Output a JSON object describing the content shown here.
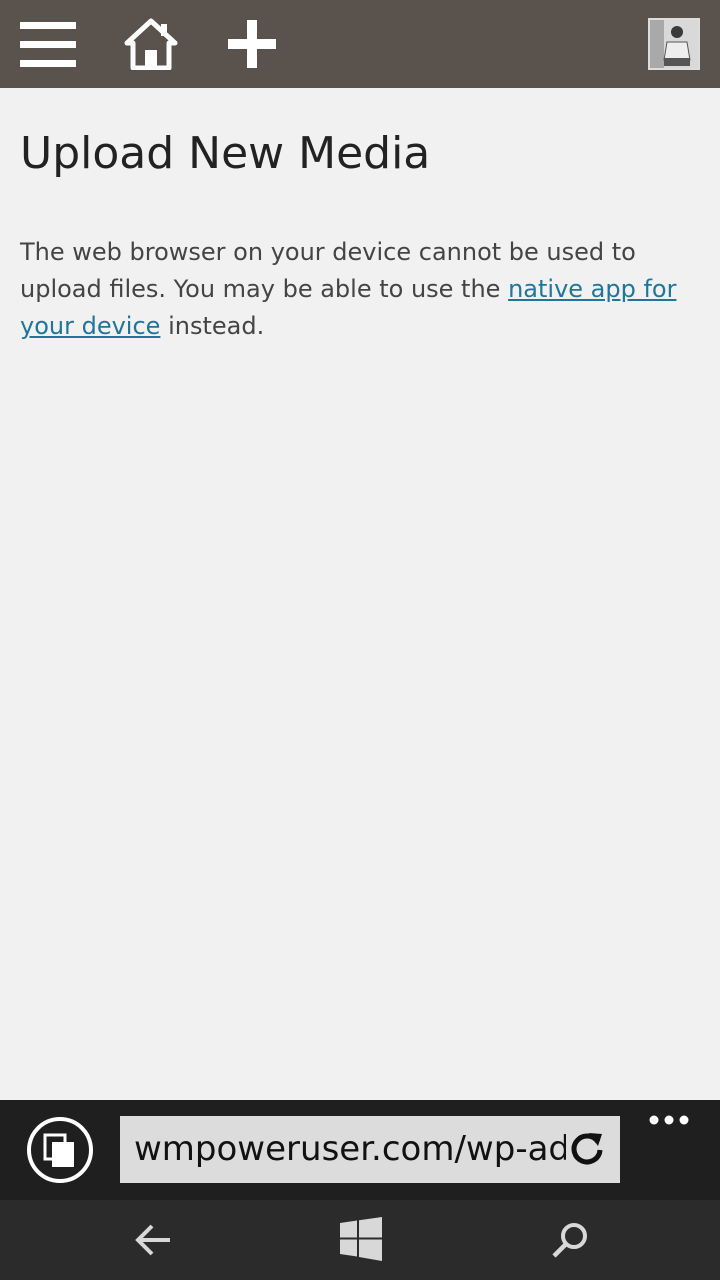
{
  "header": {
    "icons": [
      "menu-icon",
      "home-icon",
      "plus-icon",
      "user-avatar"
    ]
  },
  "page": {
    "title": "Upload New Media",
    "notice_before": "The web browser on your device cannot be used to upload files. You may be able to use the ",
    "notice_link": "native app for your device",
    "notice_after": " instead."
  },
  "browser": {
    "address": "wmpoweruser.com/wp-admin/media-new.php",
    "icons": [
      "tabs-icon",
      "refresh-icon",
      "more-icon"
    ]
  },
  "system_nav": {
    "icons": [
      "back-icon",
      "windows-icon",
      "search-icon"
    ]
  },
  "colors": {
    "topbar": "#59524d",
    "background": "#f1f1f1",
    "link": "#21759b",
    "browserbar": "#1f1f1f",
    "navbar": "#2b2b2b"
  }
}
